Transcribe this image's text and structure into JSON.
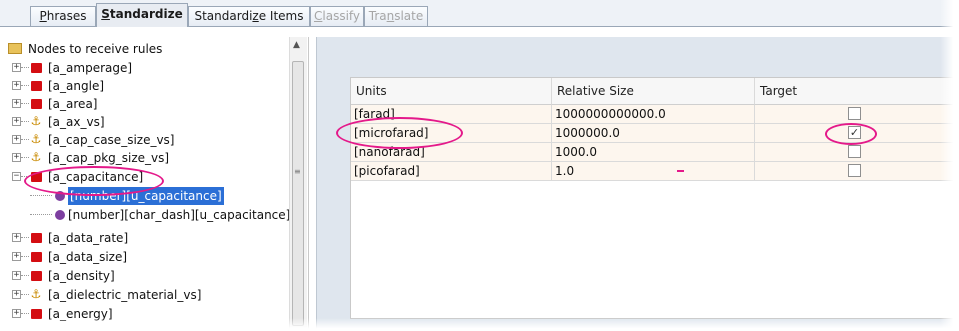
{
  "tabs": [
    {
      "label": "Phrases",
      "underline": "P",
      "rest": "hrases",
      "state": "normal"
    },
    {
      "label": "Standardize",
      "underline": "S",
      "rest": "tandardize",
      "state": "active"
    },
    {
      "label": "Standardize Items",
      "pre": "Standardi",
      "underline": "z",
      "rest": "e Items",
      "state": "normal"
    },
    {
      "label": "Classify",
      "underline": "C",
      "rest": "lassify",
      "state": "disabled"
    },
    {
      "label": "Translate",
      "pre": "Tra",
      "underline": "n",
      "rest": "slate",
      "state": "disabled"
    }
  ],
  "tree": {
    "root": "Nodes to receive rules",
    "nodes": [
      {
        "label": "[a_amperage]",
        "icon": "red-square-icon"
      },
      {
        "label": "[a_angle]",
        "icon": "red-square-icon"
      },
      {
        "label": "[a_area]",
        "icon": "red-square-icon"
      },
      {
        "label": "[a_ax_vs]",
        "icon": "anchor-icon"
      },
      {
        "label": "[a_cap_case_size_vs]",
        "icon": "anchor-icon"
      },
      {
        "label": "[a_cap_pkg_size_vs]",
        "icon": "anchor-icon"
      },
      {
        "label": "[a_capacitance]",
        "icon": "red-square-icon",
        "expanded": true
      },
      {
        "label": "[number][u_capacitance]",
        "icon": "purple-dot-icon",
        "child": true,
        "selected": true
      },
      {
        "label": "[number][char_dash][u_capacitance]",
        "icon": "purple-dot-icon",
        "child": true
      },
      {
        "label": "[a_data_rate]",
        "icon": "red-square-icon"
      },
      {
        "label": "[a_data_size]",
        "icon": "red-square-icon"
      },
      {
        "label": "[a_density]",
        "icon": "red-square-icon"
      },
      {
        "label": "[a_dielectric_material_vs]",
        "icon": "anchor-icon"
      },
      {
        "label": "[a_energy]",
        "icon": "red-square-icon"
      }
    ]
  },
  "grid": {
    "columns": [
      "Units",
      "Relative Size",
      "Target"
    ],
    "rows": [
      {
        "unit": "[farad]",
        "size": "1000000000000.0",
        "target": false
      },
      {
        "unit": "[microfarad]",
        "size": "1000000.0",
        "target": true
      },
      {
        "unit": "[nanofarad]",
        "size": "1000.0",
        "target": false
      },
      {
        "unit": "[picofarad]",
        "size": "1.0",
        "target": false
      }
    ]
  },
  "colors": {
    "annotation": "#e4198a",
    "selection": "#2b6fd6",
    "red_icon": "#d40d12",
    "purple_icon": "#7d3fa0"
  }
}
